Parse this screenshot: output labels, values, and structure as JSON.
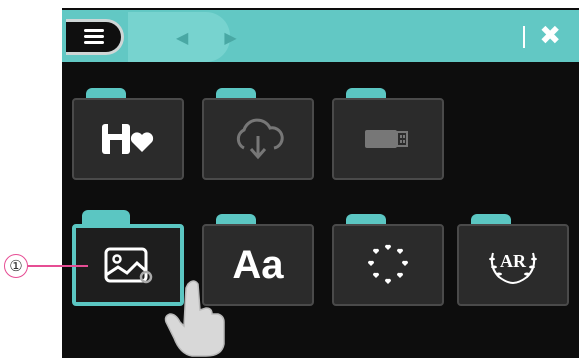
{
  "toolbar": {
    "menu_icon": "hamburger-menu-icon",
    "back_arrow": "◀",
    "forward_arrow": "▶",
    "close_label": "✖"
  },
  "folders": [
    {
      "name": "saved-favorites",
      "icon": "floppy-heart-icon",
      "selected": false
    },
    {
      "name": "cloud-download",
      "icon": "cloud-download-icon",
      "selected": false
    },
    {
      "name": "usb-storage",
      "icon": "usb-drive-icon",
      "selected": false
    },
    {
      "name": "image",
      "icon": "image-icon",
      "selected": true
    },
    {
      "name": "font",
      "icon": "font-icon",
      "label": "Aa",
      "selected": false
    },
    {
      "name": "frame-pattern",
      "icon": "heart-frame-icon",
      "selected": false
    },
    {
      "name": "monogram",
      "icon": "monogram-wreath-icon",
      "selected": false
    }
  ],
  "callout": {
    "number": "①"
  },
  "colors": {
    "accent": "#5bc6c2",
    "background": "#0d0d0d",
    "folder": "#2b2b2b",
    "callout_line": "#e64d94"
  }
}
